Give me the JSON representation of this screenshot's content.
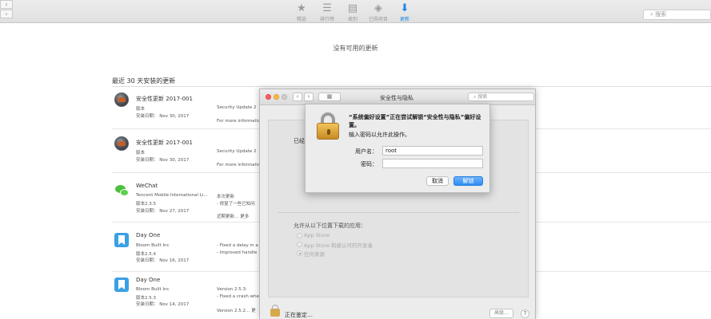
{
  "appstore": {
    "toolbar": {
      "tabs": [
        {
          "label": "精选",
          "icon": "star-icon"
        },
        {
          "label": "排行榜",
          "icon": "list-icon"
        },
        {
          "label": "类别",
          "icon": "box-icon"
        },
        {
          "label": "已购项目",
          "icon": "tag-icon"
        },
        {
          "label": "更新",
          "icon": "download-icon",
          "active": true
        }
      ],
      "search_placeholder": "搜索"
    },
    "no_updates_text": "没有可用的更新",
    "recent_title": "最近 30 天安装的更新",
    "updates": [
      {
        "name": "安全性更新 2017-001",
        "line1": "版本",
        "line2": "安装日期： Nov 30, 2017",
        "note1": "Security Update 2",
        "note2": "For more informatio",
        "icon": "security-update-icon"
      },
      {
        "name": "安全性更新 2017-001",
        "line1": "版本",
        "line2": "安装日期： Nov 30, 2017",
        "note1": "Security Update 2",
        "note2": "For more informatio",
        "icon": "security-update-icon"
      },
      {
        "name": "WeChat",
        "line1": "Tencent Mobile International Li...",
        "line2": "版本2.3.5",
        "line3": "安装日期： Nov 27, 2017",
        "note1": "本次更新",
        "note2": "- 修复了一些已知问",
        "note3": "近期更新… 更多",
        "icon": "wechat-icon"
      },
      {
        "name": "Day One",
        "line1": "Bloom Built Inc",
        "line2": "版本2.5.4",
        "line3": "安装日期： Nov 16, 2017",
        "note1": "- Fixed a delay in a",
        "note2": "- Improved handle",
        "icon": "dayone-icon"
      },
      {
        "name": "Day One",
        "line1": "Bloom Built Inc",
        "line2": "版本2.5.3",
        "line3": "安装日期： Nov 14, 2017",
        "note1": "Version 2.5.3:",
        "note2": "- Fixed a crash whe",
        "note3": "Version 2.5.2… 更",
        "icon": "dayone-icon"
      }
    ]
  },
  "security_window": {
    "title": "安全性与隐私",
    "search_placeholder": "搜索",
    "partial_text": "已经",
    "allow_title": "允许从以下位置下载的应用：",
    "options": [
      "App Store",
      "App Store 和被认可的开发者",
      "任何来源"
    ],
    "selected_option": "任何来源",
    "status_text": "正在鉴定…",
    "advanced_label": "高级…",
    "help_label": "?"
  },
  "auth_dialog": {
    "message": "“系统偏好设置”正在尝试解锁“安全性与隐私”偏好设置。",
    "sub_message": "输入密码以允许此操作。",
    "username_label": "用户名：",
    "username_value": "root",
    "password_label": "密码：",
    "password_value": "",
    "cancel_label": "取消",
    "unlock_label": "解锁"
  }
}
